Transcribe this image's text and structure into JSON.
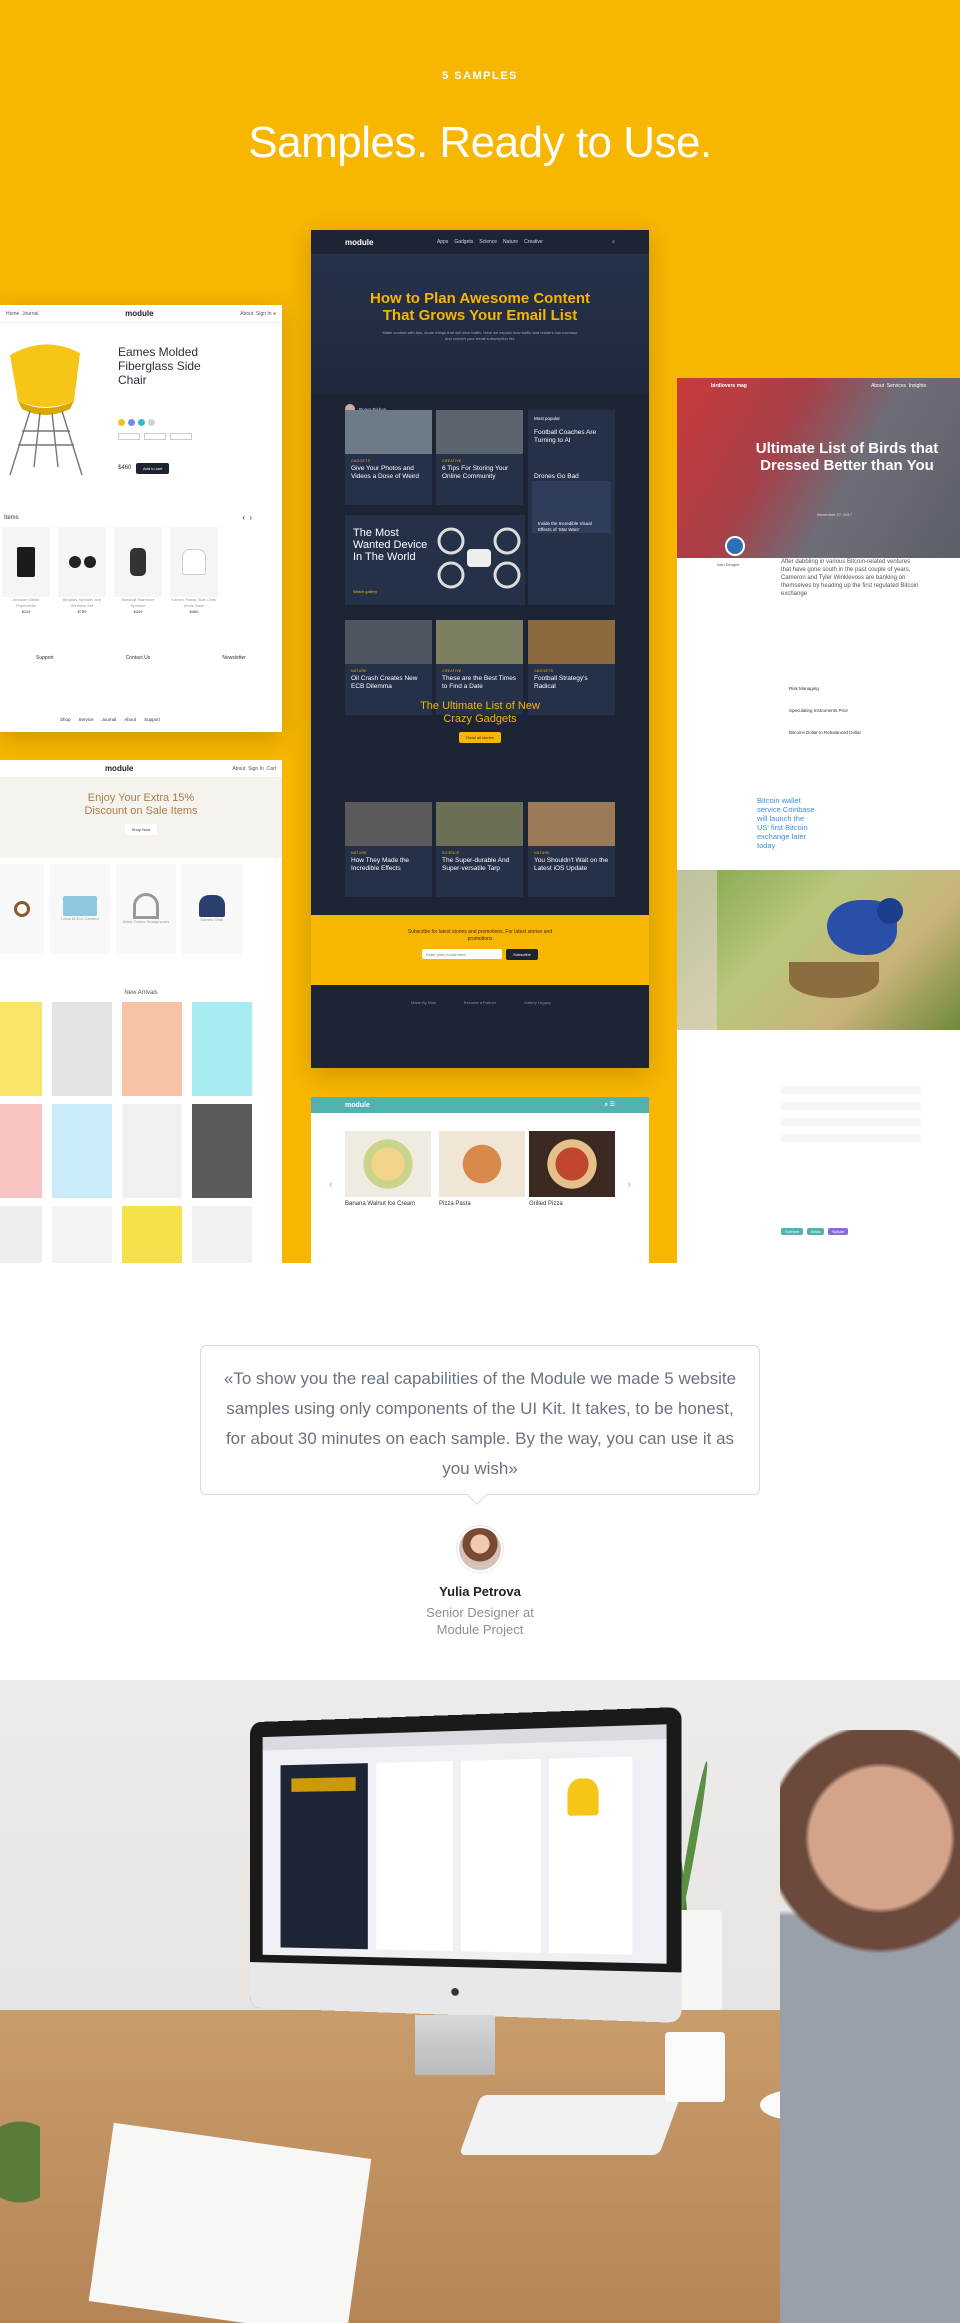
{
  "hero": {
    "tag": "5 SAMPLES",
    "title": "Samples. Ready to Use.",
    "bg_color": "#f7b600"
  },
  "shop_product": {
    "nav_links_left": [
      "Home",
      "Journal"
    ],
    "logo": "module",
    "nav_links_right": [
      "About",
      "Sign In"
    ],
    "product_title": "Eames Molded Fiberglass Side Chair",
    "price": "$460",
    "add_to_cart": "Add to cart",
    "section_label": "Items",
    "products": [
      {
        "name": "Amazon Kindle Paperwhite",
        "price": "$119"
      },
      {
        "name": "Beoplay Speaker and Wireless Set",
        "price": "$789"
      },
      {
        "name": "Marshall Stanmore Speaker",
        "price": "$349"
      },
      {
        "name": "Eames Plastic Side Chair White Base",
        "price": "$460"
      }
    ],
    "footer_cols": [
      "Support",
      "Contact Us",
      "Newsletter"
    ],
    "footer_links": [
      "Shop",
      "Service",
      "Journal",
      "About",
      "Support"
    ],
    "swatches": [
      "#f2c21b",
      "#6c8df0",
      "#3bb8c5",
      "#cfd4dc"
    ]
  },
  "shop_sale": {
    "logo": "module",
    "nav_links_right": [
      "About",
      "Sign In",
      "Cart"
    ],
    "banner_title": "Enjoy Your Extra 15% Discount on Sale Items",
    "banner_cta": "Shop Now",
    "products": [
      {
        "name": "Leica M-Eco Camera",
        "price": "$1,499"
      },
      {
        "name": "Aiaiai Tracks Headphones",
        "price": "$119"
      },
      {
        "name": "Eames Chair",
        "price": "$460"
      }
    ],
    "new_arrivals": "New Arrivals",
    "tile_colors": [
      "#f9e46a",
      "#e4e4e4",
      "#f7c3a5",
      "#a8ecf2",
      "#f7c3c3",
      "#c9ecf8",
      "#f0f0f0",
      "#5a5a5a",
      "#eeeeee",
      "#f3f3f3",
      "#f7e14b",
      "#f2f2f2"
    ]
  },
  "blog": {
    "logo": "module",
    "nav_links": [
      "Apps",
      "Gadgets",
      "Science",
      "Nature",
      "Creative"
    ],
    "hero_title": "How to Plan Awesome Content That Grows Your Email List",
    "hero_sub": "Make content with tips, share things that will drive traffic. Here we explain how traffic and readers can increase and convert your email subscription list.",
    "author": "Roger Bishop",
    "most_popular": "Most popular",
    "tiles": [
      {
        "cat": "GADGETS",
        "title": "Give Your Photos and Videos a Dose of Weird"
      },
      {
        "cat": "CREATIVE",
        "title": "6 Tips For Storing Your Online Community"
      },
      {
        "cat": "NATURE",
        "title": "Oil Crash Creates New ECB Dilemma"
      },
      {
        "cat": "CREATIVE",
        "title": "These are the Best Times to Find a Date"
      },
      {
        "cat": "GADGETS",
        "title": "Football Strategy's Radical"
      },
      {
        "cat": "NATURE",
        "title": "How They Made the Incredible Effects"
      },
      {
        "cat": "SCIENCE",
        "title": "The Super-durable And Super-versatile Tarp"
      },
      {
        "cat": "NATURE",
        "title": "You Shouldn't Wait on the Latest iOS Update"
      }
    ],
    "popular": [
      {
        "title": "Football Coaches Are Turning to AI"
      },
      {
        "title": "Drones Go Bad"
      },
      {
        "title": "Inside the Incredible Visual Effects of 'Star Wars'"
      }
    ],
    "feature_title": "The Most Wanted Device In The World",
    "feature_cta": "Watch gallery",
    "gadgets_title": "The Ultimate List of New Crazy Gadgets",
    "gadgets_cta": "Read all stories",
    "subscribe_text": "Subscribe for latest stories and promotions. For latest stories and promotions",
    "subscribe_placeholder": "Enter your e-mail here",
    "subscribe_btn": "Subscribe",
    "footer_cols": [
      "Made By Now",
      "Become a Partner",
      "Gallery Legacy"
    ]
  },
  "food": {
    "logo": "module",
    "items": [
      {
        "name": "Banana Walnut Ice Cream"
      },
      {
        "name": "Pizza Pasta"
      },
      {
        "name": "Grilled Pizza"
      }
    ]
  },
  "birds": {
    "site": "birdlovers mag",
    "nav": [
      "About",
      "Services",
      "Insights"
    ],
    "title": "Ultimate List of Birds that Dressed Better than You",
    "date": "November 27, 2017",
    "author": "Ivan Dengler",
    "intro": "After dabbling in various Bitcoin-related ventures that have gone south in the past couple of years, Cameron and Tyler Winklevoss are banking on themselves by heading up the first regulated Bitcoin exchange",
    "list": [
      "Risk Managing",
      "Speculating Instruments Prior",
      "Bitcoins Dollar to Rebalanced Dollar"
    ],
    "pullquote": "Bitcoin wallet service Coinbase will launch the US' first Bitcoin exchange later today",
    "tags": [
      "Science",
      "Birds",
      "Nature"
    ]
  },
  "quote": {
    "text": "«To show you the real capabilities of the Module we made 5 website samples using only components of the UI Kit. It takes, to be honest, for about 30 minutes on each sample. By the way, you can use it as you wish»",
    "name": "Yulia Petrova",
    "role": "Senior Designer at Module Project"
  }
}
